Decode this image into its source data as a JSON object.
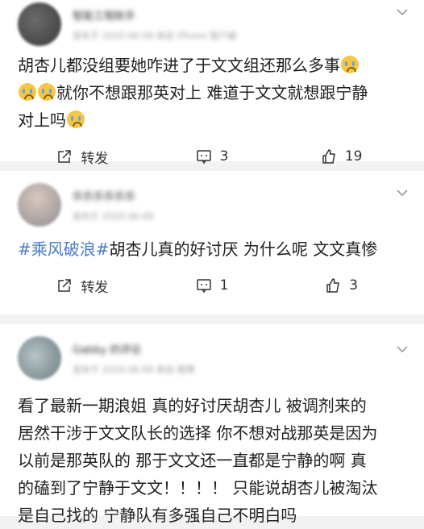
{
  "posts": [
    {
      "username": "智能工程助手",
      "meta": "发布于 2020-06-08 来自 iPhone 客户端",
      "segments": [
        {
          "t": "胡杏儿都没组要她咋进了于文文组还那么多事"
        },
        {
          "e": "crying-emoji"
        },
        {
          "t": "\n"
        },
        {
          "e": "crying-emoji"
        },
        {
          "e": "crying-emoji"
        },
        {
          "t": "就你不想跟那英对上 难道于文文就想跟宁静\n对上吗"
        },
        {
          "e": "crying-emoji"
        }
      ],
      "repost_label": "转发",
      "comment_count": "3",
      "like_count": "19"
    },
    {
      "username": "乐乐乐乐乐乐",
      "meta": "发布于 2020-06-08",
      "segments": [
        {
          "topic": "#乘风破浪#"
        },
        {
          "t": "胡杏儿真的好讨厌 为什么呢 文文真惨"
        }
      ],
      "repost_label": "转发",
      "comment_count": "1",
      "like_count": "3"
    },
    {
      "username": "Gabby 的评论",
      "meta": "发布于 2020-06-08 来自 微博",
      "segments": [
        {
          "t": "看了最新一期浪姐 真的好讨厌胡杏儿 被调剂来的\n居然干涉于文文队长的选择 你不想对战那英是因为\n以前是那英队的 那于文文还一直都是宁静的啊 真\n的磕到了宁静于文文！！！！ 只能说胡杏儿被淘汰\n是自己找的 宁静队有多强自己不明白吗"
        }
      ]
    }
  ]
}
